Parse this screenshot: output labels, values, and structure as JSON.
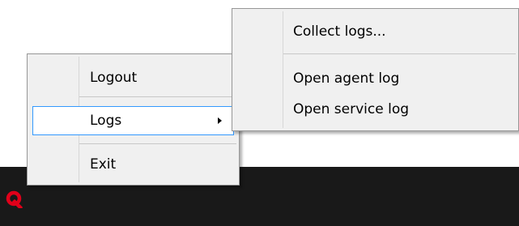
{
  "context_menu": {
    "items": [
      {
        "label": "Logout"
      },
      {
        "label": "Logs",
        "highlighted": true,
        "has_submenu": true
      },
      {
        "label": "Exit"
      }
    ]
  },
  "logs_submenu": {
    "items": [
      {
        "label": "Collect logs..."
      },
      {
        "label": "Open agent log"
      },
      {
        "label": "Open service log"
      }
    ]
  },
  "taskbar": {
    "tray_icon": "qlik-logo-icon",
    "tray_icon_color": "#e0001a",
    "background": "#191919"
  },
  "colors": {
    "menu_background": "#f0f0f0",
    "menu_border": "#979797",
    "highlight_border": "#3399ff",
    "highlight_background": "#ffffff"
  }
}
